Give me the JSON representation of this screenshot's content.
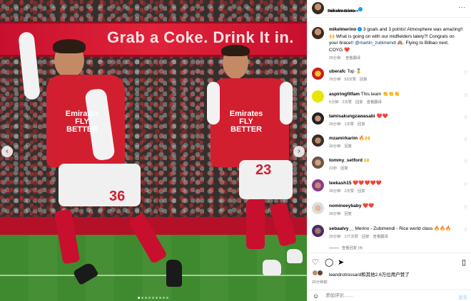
{
  "photo": {
    "banner_text": "Grab a Coke. Drink It in.",
    "sponsor_text": "Emirates FLY BETTER",
    "player1_number": "36",
    "player2_number": "23"
  },
  "header": {
    "username": "mikelmerino",
    "location": "Emirates Stadium",
    "more": "···"
  },
  "caption": {
    "username": "mikelmerino",
    "text_part1": " 3 goals and 3 points! Atmosphere was amazing!! 🙌 What is going on with our midfielders lately?! Congrats on your brace!! ",
    "mention": "@martin_zubimendi",
    "text_part2": " 🙈. Flying to Bilbao next. COYG ❤️",
    "time": "26分钟",
    "translate": "查看翻译"
  },
  "comments": [
    {
      "user": "uberafc",
      "text": "Top 🏅",
      "time": "26分钟",
      "likes": "53次赞",
      "reply": "回复"
    },
    {
      "user": "aspiringfitfam",
      "text": "This team 👏👏👏",
      "time": "5分钟",
      "likes": "2次赞",
      "reply": "回复",
      "translate": "查看翻译"
    },
    {
      "user": "tamisakungzawasabi",
      "text": "❤️❤️",
      "time": "26分钟",
      "likes": "1次赞",
      "reply": "回复"
    },
    {
      "user": "mzamirkarim",
      "text": "🔥🙌",
      "time": "26分钟",
      "reply": "回复"
    },
    {
      "user": "tommy_setford",
      "text": "🙌",
      "time": "21秒",
      "reply": "回复"
    },
    {
      "user": "teekash15",
      "text": "❤️❤️❤️❤️❤️",
      "time": "26分钟",
      "likes": "2次赞",
      "reply": "回复"
    },
    {
      "user": "nomineeybaby",
      "text": "❤️❤️",
      "time": "26分钟",
      "reply": "回复"
    },
    {
      "user": "sebaalvy__",
      "text": "Merino - Zubimendi - Rice world class 🔥🔥🔥",
      "time": "26分钟",
      "likes": "177次赞",
      "reply": "回复",
      "translate": "查看翻译"
    }
  ],
  "view_replies": "查看回复 (4)",
  "actions": {
    "liked_by": "leandrotrossard和其他2.6万位用户赞了",
    "time": "26分钟前",
    "comment_placeholder": "添加评论……",
    "post_label": "发布"
  },
  "colors": {
    "arsenal_red": "#c8102e",
    "ig_blue": "#0095f6",
    "link_blue": "#00376b",
    "heart_red": "#ed4956"
  }
}
